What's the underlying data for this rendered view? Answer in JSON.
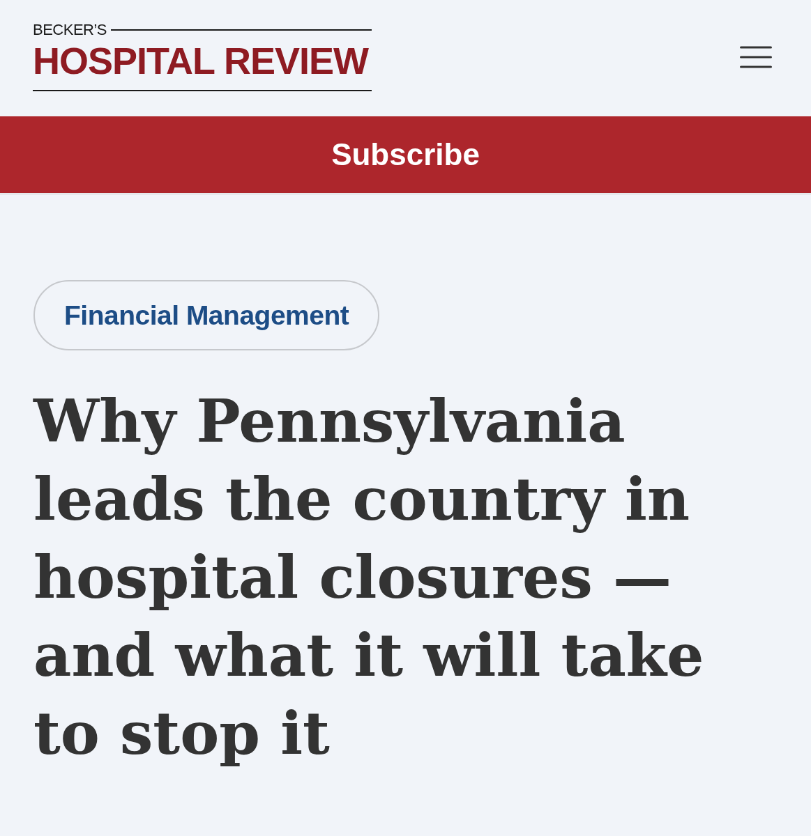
{
  "header": {
    "logo": {
      "kicker": "BECKER’S",
      "title": "HOSPITAL REVIEW"
    }
  },
  "subscribe_bar": {
    "label": "Subscribe"
  },
  "article": {
    "category": "Financial Management",
    "headline": "Why Pennsylvania leads the country in hospital closures — and what it will take to stop it"
  }
}
